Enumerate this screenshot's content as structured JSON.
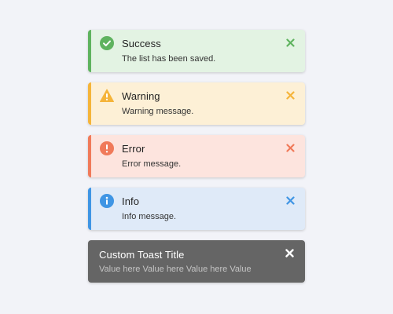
{
  "toasts": [
    {
      "type": "success",
      "title": "Success",
      "message": "The list has been saved.",
      "icon": "check-circle-icon",
      "color": "#5fb35f"
    },
    {
      "type": "warning",
      "title": "Warning",
      "message": "Warning message.",
      "icon": "warning-triangle-icon",
      "color": "#f5b43a"
    },
    {
      "type": "error",
      "title": "Error",
      "message": "Error message.",
      "icon": "exclamation-circle-icon",
      "color": "#f07a5a"
    },
    {
      "type": "info",
      "title": "Info",
      "message": "Info message.",
      "icon": "info-circle-icon",
      "color": "#3f95e4"
    }
  ],
  "custom_toast": {
    "title": "Custom Toast Title",
    "message": "Value here Value here Value here Value"
  }
}
